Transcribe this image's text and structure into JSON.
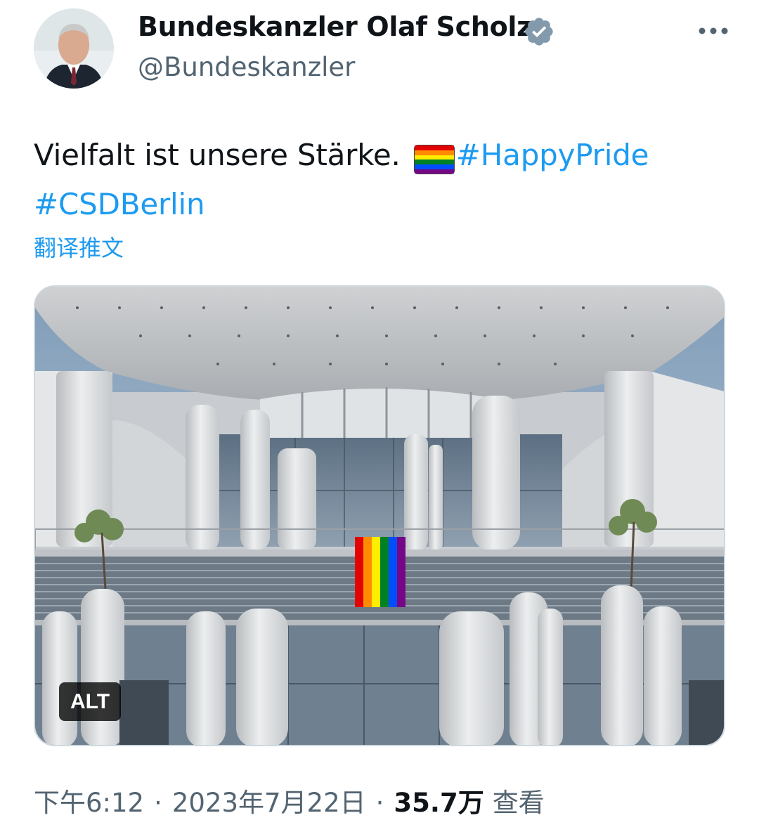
{
  "author": {
    "name": "Bundeskanzler Olaf Scholz",
    "handle": "@Bundeskanzler",
    "verified_color": "#829aab"
  },
  "more_icon": "more-horizontal-icon",
  "tweet": {
    "text_main": "Vielfalt ist unsere Stärke.",
    "emoji": "rainbow-flag",
    "hashtags": [
      "#HappyPride",
      "#CSDBerlin"
    ],
    "translate_label": "翻译推文"
  },
  "media": {
    "alt_label": "ALT"
  },
  "meta": {
    "time": "下午6:12",
    "separator": "·",
    "date": "2023年7月22日",
    "views_count": "35.7万",
    "views_label": "查看"
  },
  "colors": {
    "link": "#1d9bf0",
    "secondary_text": "#536471",
    "primary_text": "#0f1419"
  }
}
